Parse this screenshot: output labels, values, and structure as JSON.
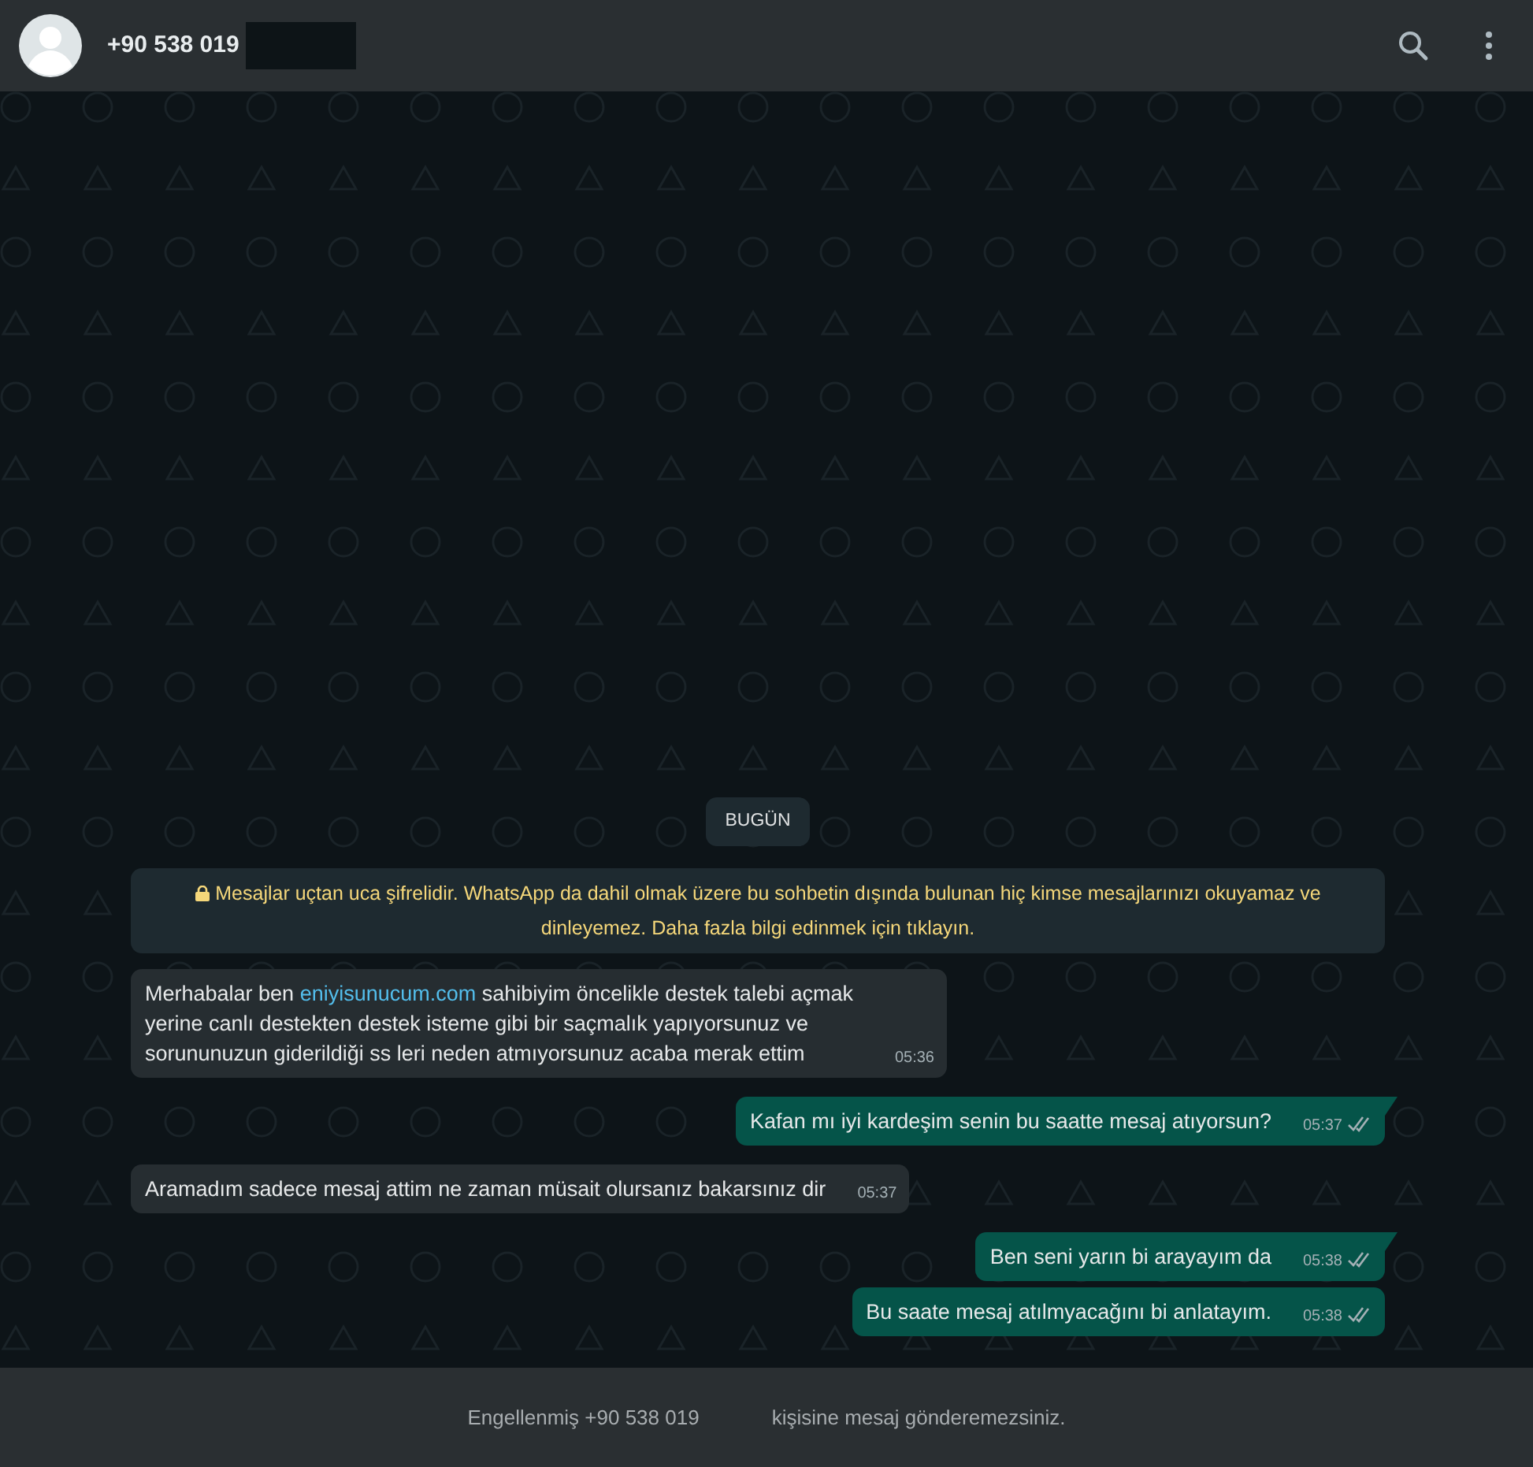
{
  "header": {
    "contact": "+90 538 019"
  },
  "chat": {
    "date_chip": "BUGÜN",
    "encryption_notice": "Mesajlar uçtan uca şifrelidir. WhatsApp da dahil olmak üzere bu sohbetin dışında bulunan hiç kimse mesajlarınızı okuyamaz ve dinleyemez. Daha fazla bilgi edinmek için tıklayın.",
    "messages": [
      {
        "kind": "incoming",
        "parts": [
          {
            "text": "Merhabalar ben "
          },
          {
            "text": "eniyisunucum.com",
            "kind": "link"
          },
          {
            "text": " sahibiyim öncelikle destek talebi açmak yerine canlı destekten destek isteme gibi bir saçmalık yapıyorsunuz ve sorununuzun giderildiği ss leri neden atmıyorsunuz acaba merak ettim"
          }
        ],
        "time": "05:36"
      },
      {
        "kind": "outgoing",
        "parts": [
          {
            "text": "Kafan mı iyi kardeşim senin bu saatte mesaj atıyorsun?"
          }
        ],
        "time": "05:37",
        "read": true,
        "tail": true
      },
      {
        "kind": "incoming",
        "parts": [
          {
            "text": "Aramadım sadece mesaj attim ne zaman müsait olursanız bakarsınız dir"
          }
        ],
        "time": "05:37"
      },
      {
        "kind": "outgoing",
        "parts": [
          {
            "text": "Ben seni yarın bi arayayım da"
          }
        ],
        "time": "05:38",
        "read": true,
        "tail": true
      },
      {
        "kind": "outgoing",
        "parts": [
          {
            "text": "Bu saate mesaj atılmyacağını bi anlatayım."
          }
        ],
        "time": "05:38",
        "read": true,
        "tail": false
      }
    ]
  },
  "footer": {
    "blocked_prefix": "Engellenmiş +90 538 019",
    "blocked_suffix": "kişisine mesaj gönderemezsiniz."
  }
}
